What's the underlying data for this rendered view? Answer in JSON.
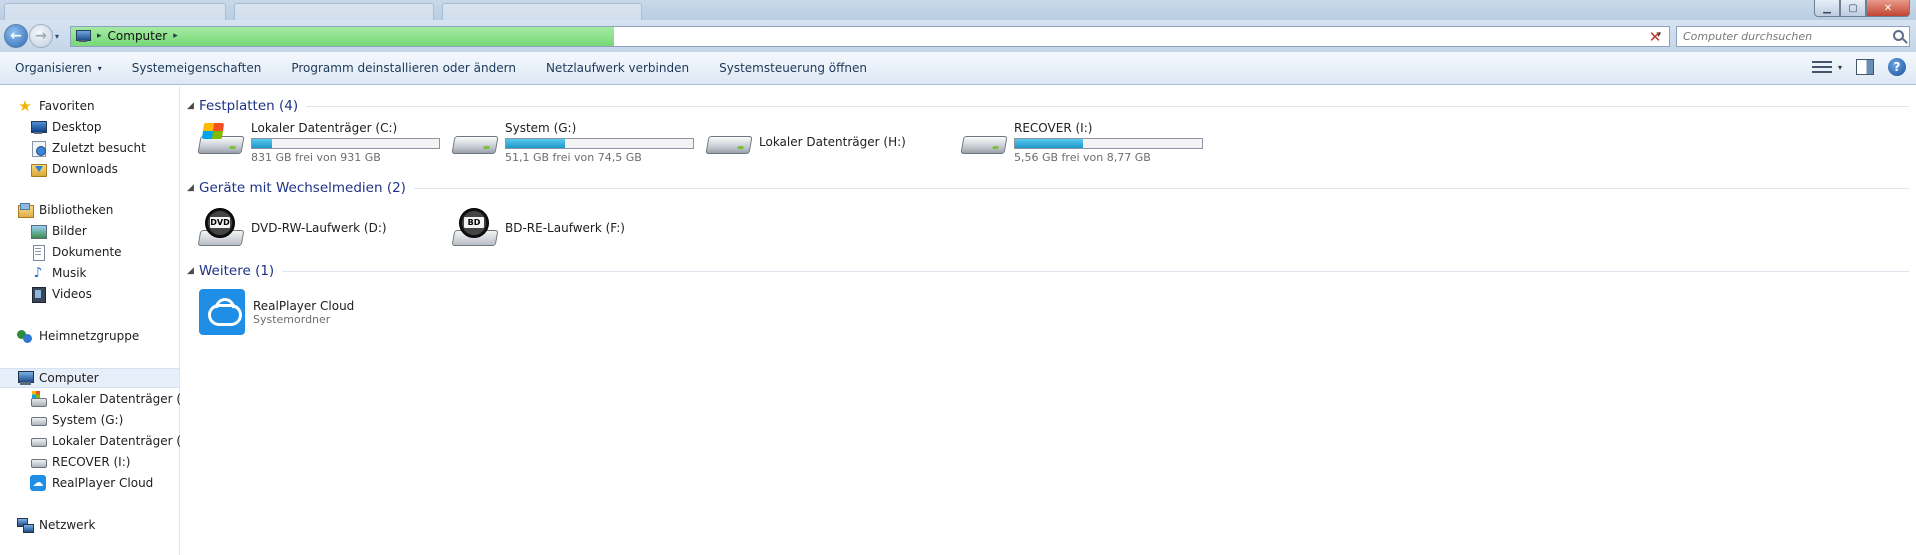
{
  "window": {
    "minimize_glyph": "▁",
    "maximize_glyph": "▢",
    "close_glyph": "✕"
  },
  "address": {
    "crumb_arrow_1": "▸",
    "location": "Computer",
    "crumb_arrow_2": "▸",
    "dropdown_glyph": "▾",
    "stop_glyph": "✕",
    "search_placeholder": "Computer durchsuchen"
  },
  "nav_buttons": {
    "back_glyph": "←",
    "forward_glyph": "→",
    "history_glyph": "▾"
  },
  "commandbar": {
    "organize": "Organisieren",
    "organize_caret": "▾",
    "system_properties": "Systemeigenschaften",
    "uninstall": "Programm deinstallieren oder ändern",
    "map_drive": "Netzlaufwerk verbinden",
    "control_panel": "Systemsteuerung öffnen",
    "view_caret": "▾",
    "help_glyph": "?"
  },
  "navpane": {
    "favorites": "Favoriten",
    "desktop": "Desktop",
    "recent": "Zuletzt besucht",
    "downloads": "Downloads",
    "libraries": "Bibliotheken",
    "pictures": "Bilder",
    "documents": "Dokumente",
    "music": "Musik",
    "videos": "Videos",
    "homegroup": "Heimnetzgruppe",
    "computer": "Computer",
    "drive_c": "Lokaler Datenträger (C:)",
    "drive_g": "System (G:)",
    "drive_h": "Lokaler Datenträger (H:)",
    "drive_i": "RECOVER (I:)",
    "realplayer": "RealPlayer Cloud",
    "network": "Netzwerk",
    "star_glyph": "★",
    "music_glyph": "♪",
    "cloud_glyph": "☁"
  },
  "groups": {
    "tri_glyph": "◢",
    "hdd": "Festplatten (4)",
    "removable": "Geräte mit Wechselmedien (2)",
    "other": "Weitere (1)"
  },
  "drives": {
    "c": {
      "name": "Lokaler Datenträger (C:)",
      "free": "831 GB frei von 931 GB",
      "used_fraction": 0.107
    },
    "g": {
      "name": "System (G:)",
      "free": "51,1 GB frei von 74,5 GB",
      "used_fraction": 0.314
    },
    "h": {
      "name": "Lokaler Datenträger (H:)"
    },
    "i": {
      "name": "RECOVER (I:)",
      "free": "5,56 GB frei von 8,77 GB",
      "used_fraction": 0.366
    }
  },
  "removable": {
    "d": {
      "name": "DVD-RW-Laufwerk (D:)",
      "disc_label": "DVD"
    },
    "f": {
      "name": "BD-RE-Laufwerk (F:)",
      "disc_label": "BD"
    }
  },
  "other": {
    "realplayer": {
      "name": "RealPlayer Cloud",
      "sub": "Systemordner"
    }
  },
  "colors": {
    "accent": "#1e3287",
    "capacity_fill": "#26a0d0",
    "progress": "#76d876"
  }
}
